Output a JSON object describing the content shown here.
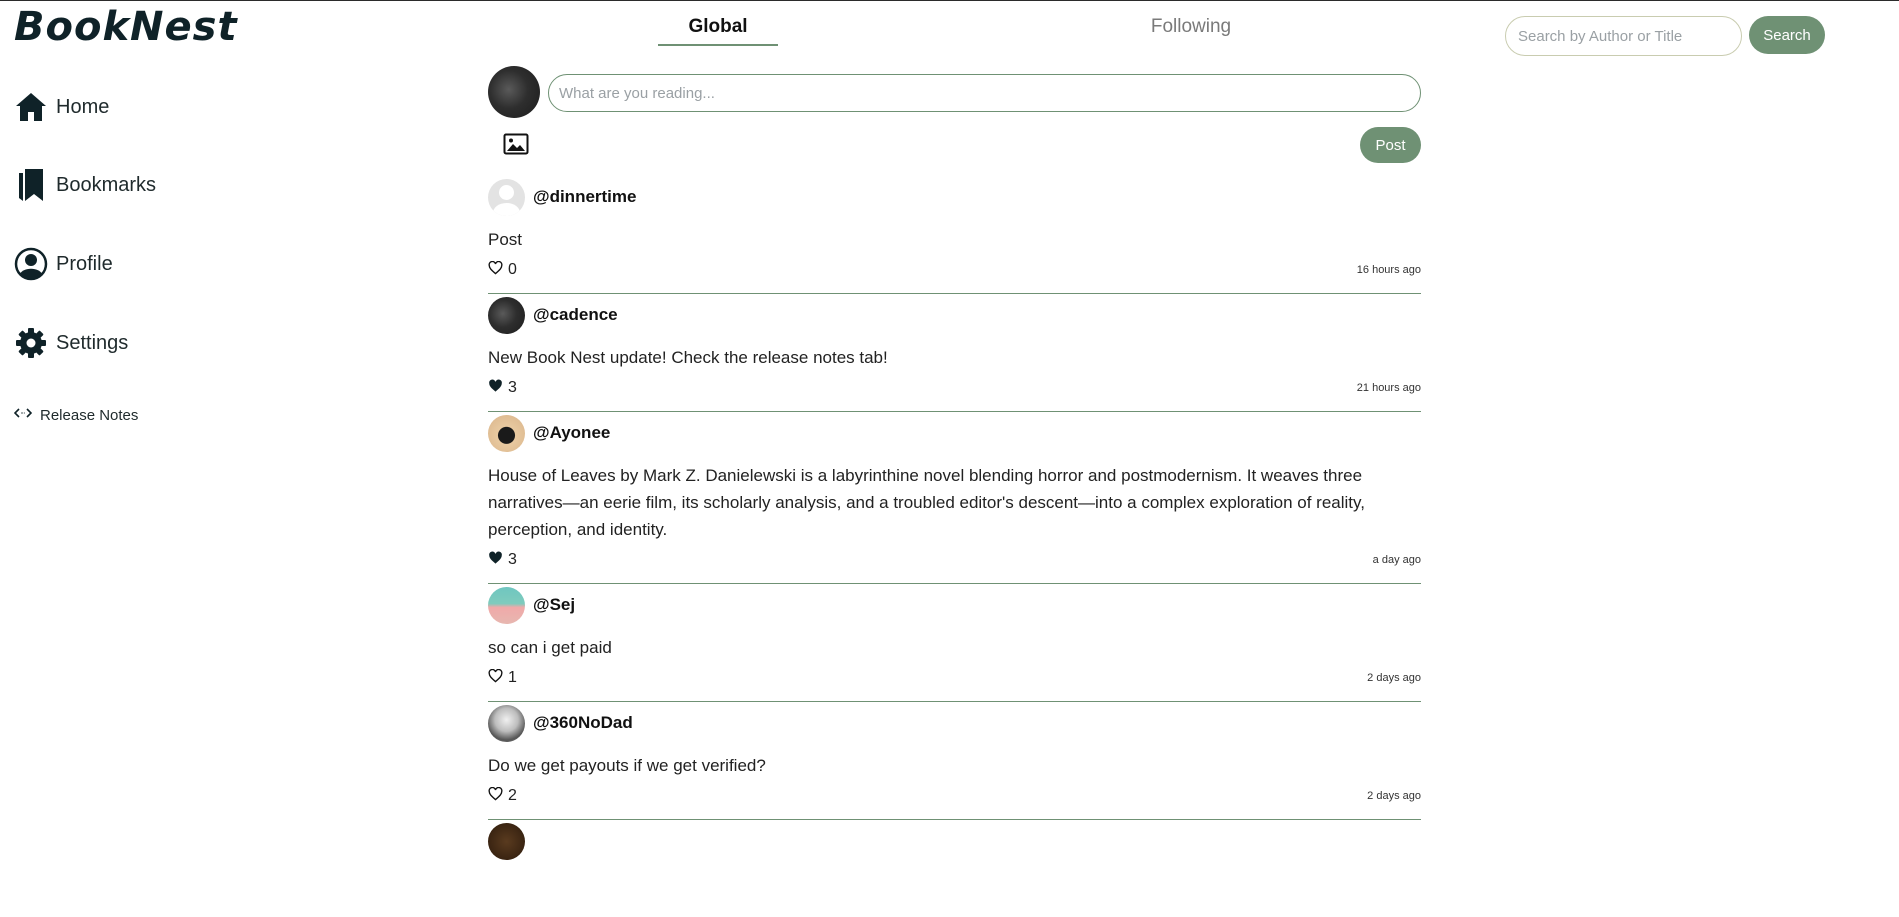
{
  "app": {
    "name": "BookNest"
  },
  "sidebar": {
    "items": [
      {
        "label": "Home",
        "icon": "home-icon"
      },
      {
        "label": "Bookmarks",
        "icon": "bookmarks-icon"
      },
      {
        "label": "Profile",
        "icon": "profile-icon"
      },
      {
        "label": "Settings",
        "icon": "gear-icon"
      }
    ],
    "release_notes": {
      "label": "Release Notes",
      "icon": "code-icon"
    }
  },
  "tabs": [
    {
      "label": "Global",
      "active": true
    },
    {
      "label": "Following",
      "active": false
    }
  ],
  "search": {
    "placeholder": "Search by Author or Title",
    "button_label": "Search"
  },
  "composer": {
    "placeholder": "What are you reading...",
    "post_label": "Post",
    "image_icon": "image-icon"
  },
  "colors": {
    "accent": "#6f9174",
    "logo": "#0f2228"
  },
  "posts": [
    {
      "handle": "@dinnertime",
      "body": "Post",
      "likes": "0",
      "liked": false,
      "time": "16 hours ago",
      "avatar": "blank"
    },
    {
      "handle": "@cadence",
      "body": "New Book Nest update! Check the release notes tab!",
      "likes": "3",
      "liked": true,
      "time": "21 hours ago",
      "avatar": "dark"
    },
    {
      "handle": "@Ayonee",
      "body": "House of Leaves by Mark Z. Danielewski is a labyrinthine novel blending horror and postmodernism. It weaves three narratives—an eerie film, its scholarly analysis, and a troubled editor's descent—into a complex exploration of reality, perception, and identity.",
      "likes": "3",
      "liked": true,
      "time": "a day ago",
      "avatar": "mask"
    },
    {
      "handle": "@Sej",
      "body": "so can i get paid",
      "likes": "1",
      "liked": false,
      "time": "2 days ago",
      "avatar": "teal"
    },
    {
      "handle": "@360NoDad",
      "body": "Do we get payouts if we get verified?",
      "likes": "2",
      "liked": false,
      "time": "2 days ago",
      "avatar": "gray"
    }
  ]
}
